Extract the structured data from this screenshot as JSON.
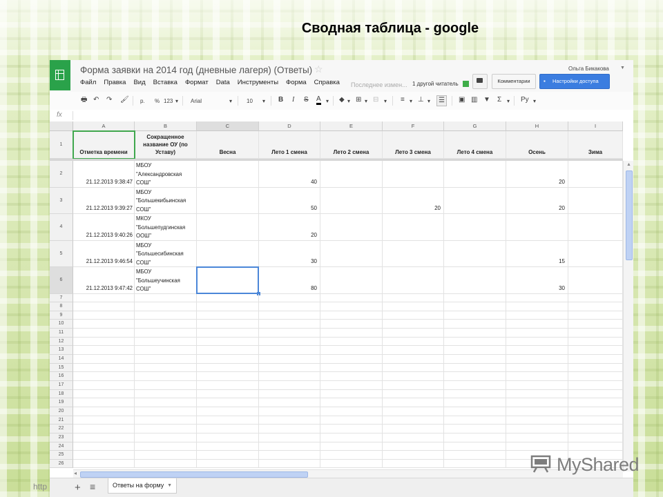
{
  "slide": {
    "title": "Сводная таблица - google",
    "url_stub": "http"
  },
  "header": {
    "doc_title": "Форма заявки на 2014 год (дневные лагеря) (Ответы)",
    "menu": [
      "Файл",
      "Правка",
      "Вид",
      "Вставка",
      "Формат",
      "Data",
      "Инструменты",
      "Форма",
      "Справка"
    ],
    "last_edit": "Последнее измен...",
    "viewer_note": "1 другой читатель",
    "comments_label": "Комментарии",
    "share_label": "Настройки доступа",
    "user_name": "Ольга Бикакова"
  },
  "toolbar": {
    "currency": "р.",
    "percent": "%",
    "format_123": "123",
    "font": "Arial",
    "font_size": "10",
    "bold": "B",
    "italic": "I",
    "strike": "S",
    "text_color": "A",
    "sum": "Σ",
    "input_tools": "Ру"
  },
  "formula_bar": {
    "label": "fx",
    "value": ""
  },
  "grid": {
    "column_letters": [
      "A",
      "B",
      "C",
      "D",
      "E",
      "F",
      "G",
      "H",
      "I"
    ],
    "column_headers": [
      "Отметка времени",
      "Сокращенное название ОУ (по Уставу)",
      "Весна",
      "Лето 1 смена",
      "Лето 2 смена",
      "Лето 3 смена",
      "Лето 4 смена",
      "Осень",
      "Зима"
    ],
    "rows": [
      {
        "num": "2",
        "timestamp": "21.12.2013 9:38:47",
        "name": [
          "МБОУ",
          "\"Александровская",
          "СОШ\""
        ],
        "vesna": "",
        "leto1": "40",
        "leto2": "",
        "leto3": "",
        "leto4": "",
        "osen": "20",
        "zima": ""
      },
      {
        "num": "3",
        "timestamp": "21.12.2013 9:39:27",
        "name": [
          "МБОУ",
          "\"Большекибьинская",
          "СОШ\""
        ],
        "vesna": "",
        "leto1": "50",
        "leto2": "",
        "leto3": "20",
        "leto4": "",
        "osen": "20",
        "zima": ""
      },
      {
        "num": "4",
        "timestamp": "21.12.2013 9:40:26",
        "name": [
          "МКОУ",
          "\"Большепудгинская",
          "ООШ\""
        ],
        "vesna": "",
        "leto1": "20",
        "leto2": "",
        "leto3": "",
        "leto4": "",
        "osen": "",
        "zima": ""
      },
      {
        "num": "5",
        "timestamp": "21.12.2013 9:46:54",
        "name": [
          "МБОУ",
          "\"Большесибинская",
          "СОШ\""
        ],
        "vesna": "",
        "leto1": "30",
        "leto2": "",
        "leto3": "",
        "leto4": "",
        "osen": "15",
        "zima": ""
      },
      {
        "num": "6",
        "timestamp": "21.12.2013 9:47:42",
        "name": [
          "МБОУ",
          "\"Большеучинская",
          "СОШ\""
        ],
        "vesna": "",
        "leto1": "80",
        "leto2": "",
        "leto3": "",
        "leto4": "",
        "osen": "30",
        "zima": ""
      }
    ],
    "empty_row_numbers": [
      "7",
      "8",
      "9",
      "10",
      "11",
      "12",
      "13",
      "14",
      "15",
      "16",
      "17",
      "18",
      "19",
      "20",
      "21",
      "22",
      "23",
      "24",
      "25",
      "26"
    ],
    "header_row_number": "1"
  },
  "sheet_tabs": {
    "active_tab": "Ответы на форму",
    "add_icon": "plus-icon",
    "list_icon": "list-icon"
  },
  "watermark": {
    "text": "MyShared"
  },
  "colors": {
    "sheets_green": "#2aa24a",
    "share_blue": "#3b7de0",
    "selection_blue": "#4a86d8",
    "selection_green": "#3fa74d"
  }
}
